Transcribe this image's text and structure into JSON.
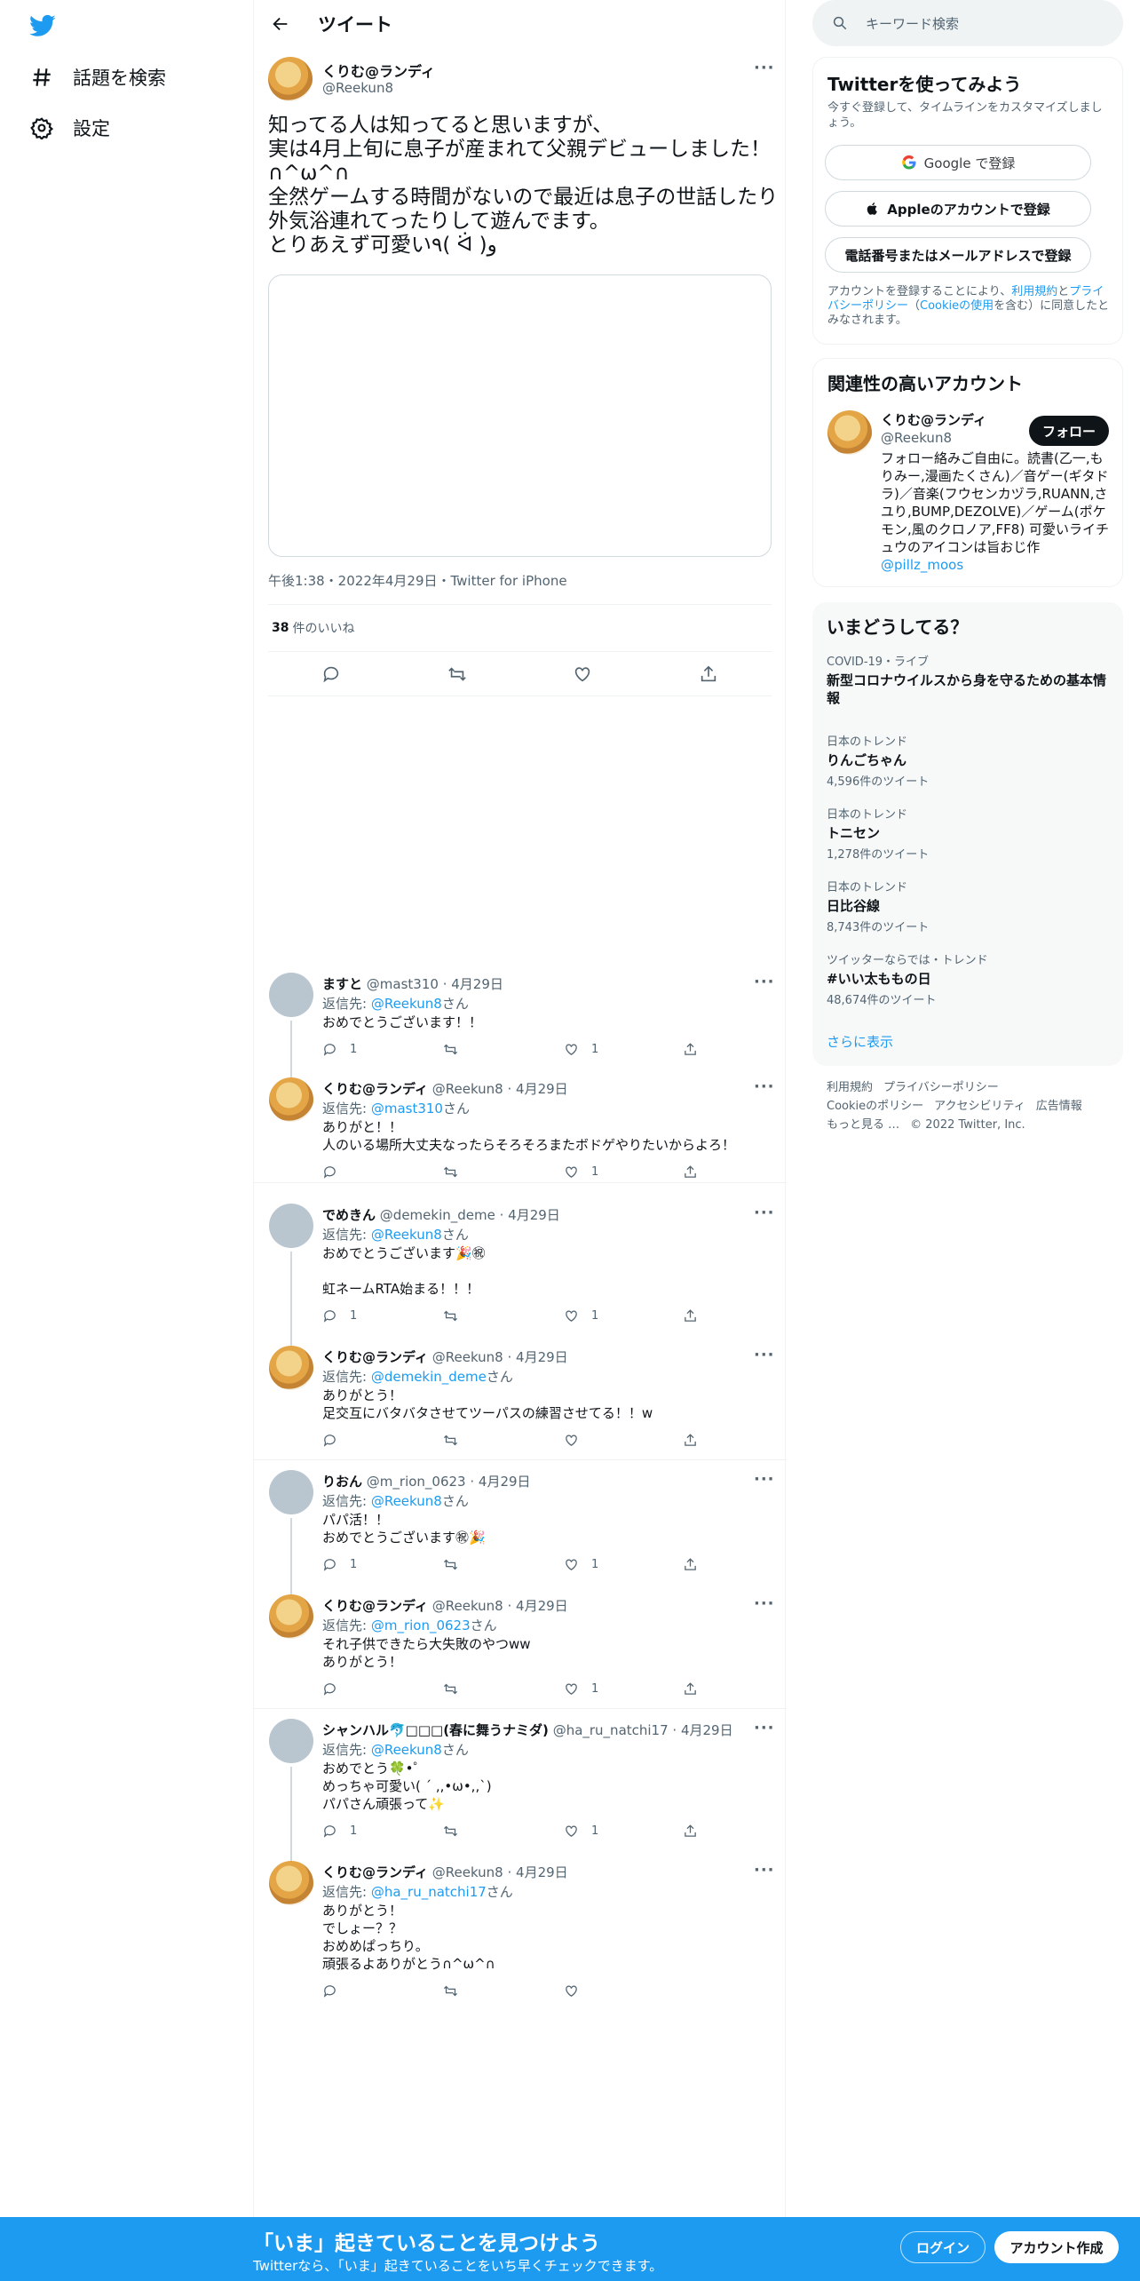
{
  "nav": {
    "explore_label": "話題を検索",
    "settings_label": "設定"
  },
  "header": {
    "title": "ツイート"
  },
  "tweet": {
    "name": "くりむ@ランディ",
    "handle": "@Reekun8",
    "text": "知ってる人は知ってると思いますが、\n実は4月上旬に息子が産まれて父親デビューしました！∩^ω^∩\n全然ゲームする時間がないので最近は息子の世話したり外気浴連れてったりして遊んでます。\nとりあえず可愛い٩( ᐛ )و",
    "meta": "午後1:38・2022年4月29日・Twitter for iPhone",
    "like_count": "38",
    "like_label": "件のいいね"
  },
  "replies": [
    {
      "name": "ますと",
      "handle": "@mast310",
      "date": "4月29日",
      "reply_prefix": "返信先: ",
      "reply_to": "@Reekun8",
      "reply_suffix": "さん",
      "text": "おめでとうございます！！",
      "reply_count": "1",
      "like_count": "1"
    },
    {
      "name": "くりむ@ランディ",
      "handle": "@Reekun8",
      "date": "4月29日",
      "reply_prefix": "返信先: ",
      "reply_to": "@mast310",
      "reply_suffix": "さん",
      "text": "ありがと！！\n人のいる場所大丈夫なったらそろそろまたボドゲやりたいからよろ！",
      "reply_count": "",
      "like_count": "1"
    },
    {
      "name": "でめきん",
      "handle": "@demekin_deme",
      "date": "4月29日",
      "reply_prefix": "返信先: ",
      "reply_to": "@Reekun8",
      "reply_suffix": "さん",
      "text": "おめでとうございます🎉㊗\n\n虹ネームRTA始まる！！！",
      "reply_count": "1",
      "like_count": "1"
    },
    {
      "name": "くりむ@ランディ",
      "handle": "@Reekun8",
      "date": "4月29日",
      "reply_prefix": "返信先: ",
      "reply_to": "@demekin_deme",
      "reply_suffix": "さん",
      "text": "ありがとう！\n足交互にバタバタさせてツーパスの練習させてる！！w",
      "reply_count": "",
      "like_count": ""
    },
    {
      "name": "りおん",
      "handle": "@m_rion_0623",
      "date": "4月29日",
      "reply_prefix": "返信先: ",
      "reply_to": "@Reekun8",
      "reply_suffix": "さん",
      "text": "パパ活！！\nおめでとうございます㊗🎉",
      "reply_count": "1",
      "like_count": "1"
    },
    {
      "name": "くりむ@ランディ",
      "handle": "@Reekun8",
      "date": "4月29日",
      "reply_prefix": "返信先: ",
      "reply_to": "@m_rion_0623",
      "reply_suffix": "さん",
      "text": "それ子供できたら大失敗のやつww\nありがとう！",
      "reply_count": "",
      "like_count": "1"
    },
    {
      "name": "シャンハル🐬□□□(春に舞うナミダ)",
      "handle": "@ha_ru_natchi17",
      "date": "4月29日",
      "reply_prefix": "返信先: ",
      "reply_to": "@Reekun8",
      "reply_suffix": "さん",
      "text": "おめでとう🍀•゜\nめっちゃ可愛い( ´ ,,•ω•,,`)\nパパさん頑張って✨",
      "reply_count": "1",
      "like_count": "1"
    },
    {
      "name": "くりむ@ランディ",
      "handle": "@Reekun8",
      "date": "4月29日",
      "reply_prefix": "返信先: ",
      "reply_to": "@ha_ru_natchi17",
      "reply_suffix": "さん",
      "text": "ありがとう！\nでしょー？？\nおめめぱっちり。\n頑張るよありがとう∩^ω^∩",
      "reply_count": "",
      "like_count": ""
    }
  ],
  "search": {
    "placeholder": "キーワード検索"
  },
  "signup": {
    "title": "Twitterを使ってみよう",
    "subtitle": "今すぐ登録して、タイムラインをカスタマイズしましょう。",
    "google_label": "Google で登録",
    "apple_label": "Appleのアカウントで登録",
    "phone_label": "電話番号またはメールアドレスで登録",
    "legal_pre": "アカウントを登録することにより、",
    "legal_link1": "利用規約",
    "legal_mid": "と",
    "legal_link2": "プライバシーポリシー",
    "legal_paren_open": "（",
    "legal_link3": "Cookieの使用",
    "legal_post": "を含む）に同意したとみなされます。"
  },
  "related": {
    "title": "関連性の高いアカウント",
    "name": "くりむ@ランディ",
    "handle": "@Reekun8",
    "follow_label": "フォロー",
    "bio": "フォロー絡みご自由に。読書(乙一,もりみー,漫画たくさん)／音ゲー(ギタドラ)／音楽(フウセンカヅラ,RUANN,さユり,BUMP,DEZOLVE)／ゲーム(ポケモン,風のクロノア,FF8) 可愛いライチュウのアイコンは旨おじ作 ",
    "bio_link": "@pillz_moos"
  },
  "trends": {
    "title": "いまどうしてる？",
    "items": [
      {
        "context": "COVID-19・ライブ",
        "title": "新型コロナウイルスから身を守るための基本情報",
        "count": ""
      },
      {
        "context": "日本のトレンド",
        "title": "りんごちゃん",
        "count": "4,596件のツイート"
      },
      {
        "context": "日本のトレンド",
        "title": "トニセン",
        "count": "1,278件のツイート"
      },
      {
        "context": "日本のトレンド",
        "title": "日比谷線",
        "count": "8,743件のツイート"
      },
      {
        "context": "ツイッターならでは・トレンド",
        "title": "#いい太ももの日",
        "count": "48,674件のツイート"
      }
    ],
    "show_more": "さらに表示"
  },
  "footer": {
    "links": [
      "利用規約",
      "プライバシーポリシー",
      "Cookieのポリシー",
      "アクセシビリティ",
      "広告情報",
      "もっと見る …"
    ],
    "copyright": "© 2022 Twitter, Inc."
  },
  "bottom_bar": {
    "title": "「いま」起きていることを見つけよう",
    "subtitle": "Twitterなら、「いま」起きていることをいち早くチェックできます。",
    "login_label": "ログイン",
    "signup_label": "アカウント作成"
  },
  "colors": {
    "accent": "#1d9bf0",
    "text": "#0f1419",
    "muted": "#536471"
  }
}
